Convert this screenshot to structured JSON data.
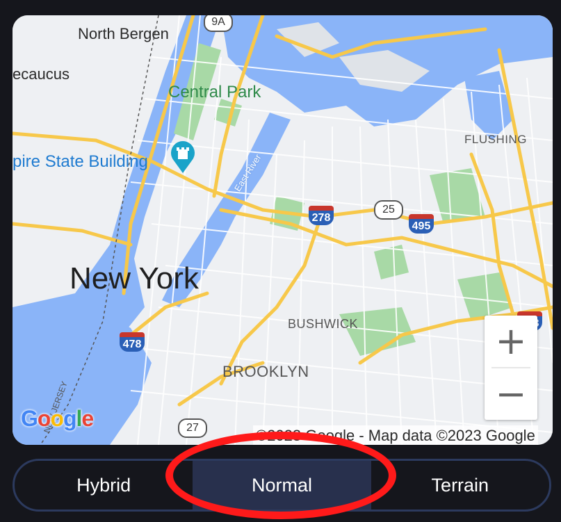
{
  "map": {
    "labels": {
      "north_bergen": "North Bergen",
      "secaucus": "ecaucus",
      "central_park": "Central Park",
      "empire_state": "pire State Building",
      "flushing": "FLUSHING",
      "east_river": "East River",
      "new_york": "New York",
      "bushwick": "BUSHWICK",
      "brooklyn": "BROOKLYN",
      "new_jersey": "NEW JERSEY"
    },
    "shields": {
      "r9a": "9A",
      "i278": "278",
      "r25": "25",
      "i495": "495",
      "i478": "478",
      "i678": "678",
      "r27": "27"
    },
    "zoom_in": "+",
    "zoom_out": "−",
    "google_logo": "Google",
    "attribution": "©2023 Google - Map data ©2023 Google"
  },
  "map_type_selector": {
    "options": [
      "Hybrid",
      "Normal",
      "Terrain"
    ],
    "selected": "Normal"
  },
  "colors": {
    "background": "#15161c",
    "water": "#8ab4f8",
    "highway": "#f7c84a",
    "park": "#a8d9a6",
    "selected_segment": "#28304d",
    "highlight_ring": "#ff1a1a"
  }
}
